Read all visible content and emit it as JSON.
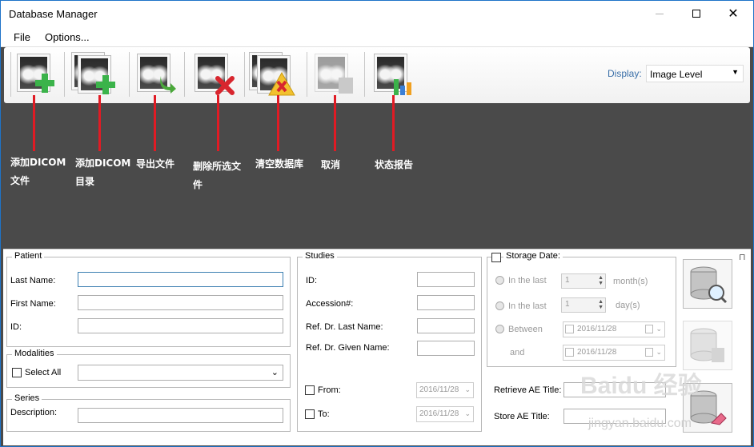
{
  "window": {
    "title": "Database Manager"
  },
  "menu": {
    "file": "File",
    "options": "Options..."
  },
  "toolbar": {
    "display_label": "Display:",
    "display_value": "Image Level"
  },
  "annotations": {
    "add_dicom_file": [
      "添加DICOM",
      "文件"
    ],
    "add_dicom_dir": [
      "添加DICOM",
      "目录"
    ],
    "export_file": [
      "导出文件"
    ],
    "delete_selected": [
      "删除所选文",
      "件"
    ],
    "clear_database": [
      "清空数据库"
    ],
    "cancel": [
      "取消"
    ],
    "status_report": [
      "状态报告"
    ]
  },
  "patient": {
    "legend": "Patient",
    "last_name_label": "Last Name:",
    "first_name_label": "First Name:",
    "id_label": "ID:",
    "last_name": "",
    "first_name": "",
    "id": ""
  },
  "modalities": {
    "legend": "Modalities",
    "select_all_label": "Select All",
    "selected": ""
  },
  "series": {
    "legend": "Series",
    "description_label": "Description:",
    "description": ""
  },
  "studies": {
    "legend": "Studies",
    "id_label": "ID:",
    "accession_label": "Accession#:",
    "ref_last_label": "Ref. Dr. Last Name:",
    "ref_given_label": "Ref. Dr. Given Name:",
    "from_label": "From:",
    "to_label": "To:",
    "from_date": "2016/11/28",
    "to_date": "2016/11/28"
  },
  "storage": {
    "legend": "Storage Date:",
    "in_the_last_1": "In the last",
    "in_the_last_2": "In the last",
    "months_value": "1",
    "months_unit": "month(s)",
    "days_value": "1",
    "days_unit": "day(s)",
    "between_label": "Between",
    "and_label": "and",
    "between_date": "2016/11/28",
    "and_date": "2016/11/28"
  },
  "ae": {
    "retrieve_label": "Retrieve AE Title:",
    "store_label": "Store AE Title:",
    "retrieve_value": "",
    "store_value": ""
  },
  "watermark": {
    "brand": "Baidu 经验",
    "url": "jingyan.baidu.com"
  },
  "colors": {
    "annotation_line": "#e01b24",
    "panel_bg": "#4a4a4a",
    "accent": "#3a6fa8"
  }
}
